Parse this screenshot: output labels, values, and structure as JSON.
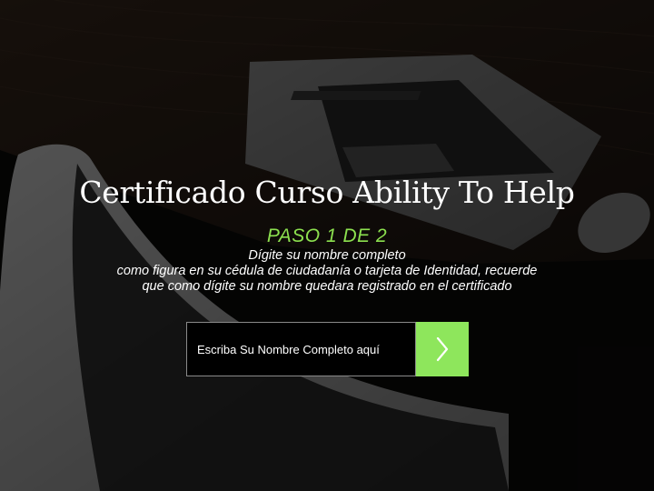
{
  "page": {
    "title": "Certificado Curso Ability To Help",
    "step": "PASO 1 DE 2",
    "instructions": [
      "Dígite su nombre completo",
      "como figura en su cédula de ciudadanía o tarjeta de Identidad, recuerde",
      "que como dígite su nombre quedara registrado en el certificado"
    ]
  },
  "form": {
    "name_placeholder": "Escriba Su Nombre Completo aquí",
    "submit_icon": "chevron-right-icon"
  },
  "colors": {
    "accent": "#8ee65c",
    "step_text": "#8ce04f",
    "input_bg": "#000000",
    "text": "#ffffff"
  }
}
